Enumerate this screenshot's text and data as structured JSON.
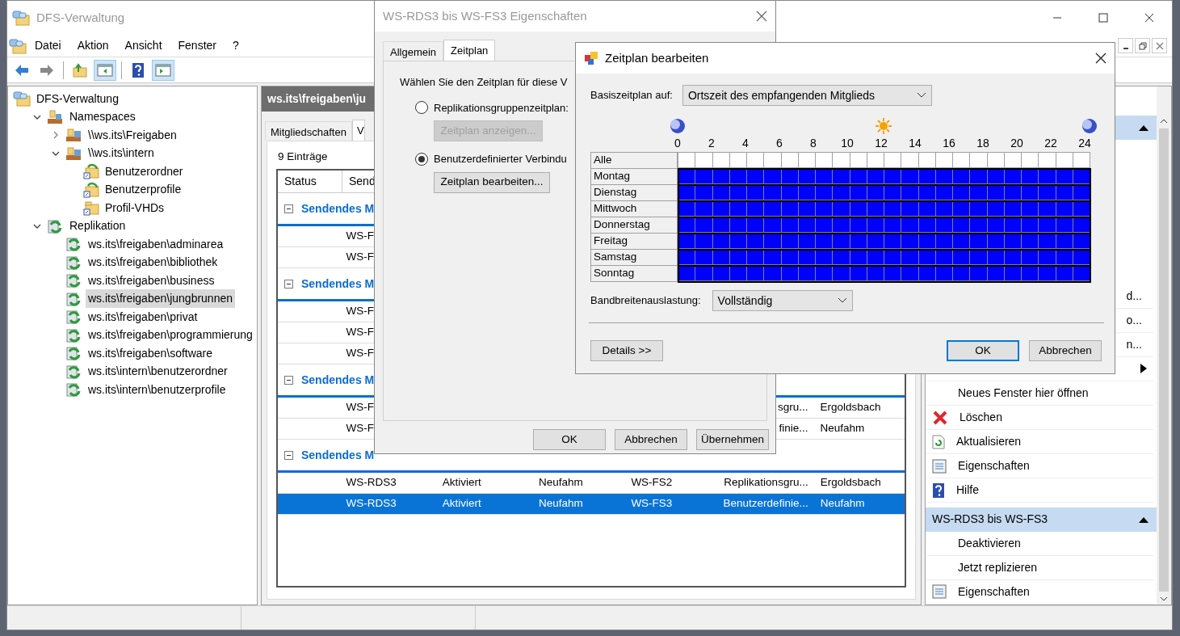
{
  "main_window": {
    "title": "DFS-Verwaltung",
    "menu": [
      "Datei",
      "Aktion",
      "Ansicht",
      "Fenster",
      "?"
    ],
    "toolbar": [
      {
        "kind": "back"
      },
      {
        "kind": "forward"
      },
      {
        "kind": "separator"
      },
      {
        "kind": "up",
        "pressed": false
      },
      {
        "kind": "tree",
        "pressed": true
      },
      {
        "kind": "separator"
      },
      {
        "kind": "help",
        "pressed": false
      },
      {
        "kind": "actions",
        "pressed": true
      }
    ]
  },
  "tree": [
    {
      "label": "DFS-Verwaltung",
      "kind": "root",
      "selected": false,
      "children": [
        {
          "label": "Namespaces",
          "kind": "namespaces",
          "selected": false,
          "expanded": true,
          "children": [
            {
              "label": "\\\\ws.its\\Freigaben",
              "kind": "namespace",
              "selected": false,
              "expanded": false
            },
            {
              "label": "\\\\ws.its\\intern",
              "kind": "namespace",
              "selected": false,
              "expanded": true,
              "children": [
                {
                  "label": "Benutzerordner",
                  "kind": "link",
                  "selected": false
                },
                {
                  "label": "Benutzerprofile",
                  "kind": "link",
                  "selected": false
                },
                {
                  "label": "Profil-VHDs",
                  "kind": "folder",
                  "selected": false
                }
              ]
            }
          ]
        },
        {
          "label": "Replikation",
          "kind": "replication",
          "selected": false,
          "expanded": true,
          "children": [
            {
              "label": "ws.its\\freigaben\\adminarea",
              "kind": "group",
              "selected": false
            },
            {
              "label": "ws.its\\freigaben\\bibliothek",
              "kind": "group",
              "selected": false
            },
            {
              "label": "ws.its\\freigaben\\business",
              "kind": "group",
              "selected": false
            },
            {
              "label": "ws.its\\freigaben\\jungbrunnen",
              "kind": "group",
              "selected": true
            },
            {
              "label": "ws.its\\freigaben\\privat",
              "kind": "group",
              "selected": false
            },
            {
              "label": "ws.its\\freigaben\\programmierung",
              "kind": "group",
              "selected": false
            },
            {
              "label": "ws.its\\freigaben\\software",
              "kind": "group",
              "selected": false
            },
            {
              "label": "ws.its\\intern\\benutzerordner",
              "kind": "group",
              "selected": false
            },
            {
              "label": "ws.its\\intern\\benutzerprofile",
              "kind": "group",
              "selected": false
            }
          ]
        }
      ]
    }
  ],
  "content": {
    "header": "ws.its\\freigaben\\ju",
    "tabs": [
      {
        "label": "Mitgliedschaften",
        "selected": false
      },
      {
        "label": "V",
        "selected": true
      }
    ],
    "count": "9 Einträge",
    "columns": [
      "Status",
      "Send"
    ],
    "groups": [
      {
        "title": "Sendendes M",
        "expanded": true,
        "rows": [
          {
            "selected": false,
            "column_2": "WS-F"
          },
          {
            "selected": false,
            "column_2": "WS-F"
          }
        ]
      },
      {
        "title": "Sendendes M",
        "expanded": true,
        "rows": [
          {
            "selected": false,
            "column_2": "WS-F"
          },
          {
            "selected": false,
            "column_2": "WS-F"
          },
          {
            "selected": false,
            "column_2": "WS-F"
          }
        ]
      },
      {
        "title": "Sendendes M",
        "expanded": true,
        "rows": [
          {
            "selected": false,
            "column_2": "WS-F",
            "column_6": "sgru...",
            "column_7": "Ergoldsbach"
          },
          {
            "selected": false,
            "column_2": "WS-F",
            "column_6": "finie...",
            "column_7": "Neufahm"
          }
        ]
      },
      {
        "title": "Sendendes M",
        "expanded": true,
        "rows": [
          {
            "selected": false,
            "column_2": "WS-RDS3",
            "column_3": "Aktiviert",
            "column_4": "Neufahm",
            "column_5": "WS-FS2",
            "column_6": "Replikationsgru...",
            "column_7": "Ergoldsbach"
          },
          {
            "selected": true,
            "column_2": "WS-RDS3",
            "column_3": "Aktiviert",
            "column_4": "Neufahm",
            "column_5": "WS-FS3",
            "column_6": "Benutzerdefinie...",
            "column_7": "Neufahm"
          }
        ]
      }
    ]
  },
  "actions": {
    "items": [
      {
        "kind": "partial",
        "label": "d..."
      },
      {
        "kind": "partial",
        "label": "o..."
      },
      {
        "kind": "partial",
        "label": "n..."
      },
      {
        "kind": "submenu"
      },
      {
        "kind": "plain",
        "label": "Neues Fenster hier öffnen"
      },
      {
        "kind": "delete",
        "label": "Löschen"
      },
      {
        "kind": "refresh",
        "label": "Aktualisieren"
      },
      {
        "kind": "properties",
        "label": "Eigenschaften"
      },
      {
        "kind": "help",
        "label": "Hilfe"
      }
    ],
    "section": "WS-RDS3 bis WS-FS3",
    "section_items": [
      {
        "kind": "plain",
        "label": "Deaktivieren"
      },
      {
        "kind": "plain",
        "label": "Jetzt replizieren"
      },
      {
        "kind": "properties",
        "label": "Eigenschaften"
      }
    ]
  },
  "properties_dialog": {
    "title": "WS-RDS3 bis WS-FS3 Eigenschaften",
    "tabs": [
      {
        "label": "Allgemein",
        "selected": false
      },
      {
        "label": "Zeitplan",
        "selected": true
      }
    ],
    "prompt": "Wählen Sie den Zeitplan für diese V",
    "options": [
      {
        "label": "Replikationsgruppenzeitplan:",
        "selected": false,
        "button": {
          "label": "Zeitplan anzeigen...",
          "disabled": true
        }
      },
      {
        "label": "Benutzerdefinierter Verbindu",
        "selected": true,
        "button": {
          "label": "Zeitplan bearbeiten...",
          "disabled": false
        }
      }
    ],
    "buttons": [
      "OK",
      "Abbrechen",
      "Übernehmen"
    ]
  },
  "schedule_dialog": {
    "title": "Zeitplan bearbeiten",
    "base_label": "Basiszeitplan auf:",
    "base_value": "Ortszeit des empfangenden Mitglieds",
    "hours": [
      "0",
      "2",
      "4",
      "6",
      "8",
      "10",
      "12",
      "14",
      "16",
      "18",
      "20",
      "22",
      "24"
    ],
    "all_label": "Alle",
    "days": [
      {
        "label": "Montag",
        "active": true
      },
      {
        "label": "Dienstag",
        "active": true
      },
      {
        "label": "Mittwoch",
        "active": true
      },
      {
        "label": "Donnerstag",
        "active": true
      },
      {
        "label": "Freitag",
        "active": true
      },
      {
        "label": "Samstag",
        "active": true
      },
      {
        "label": "Sonntag",
        "active": true
      }
    ],
    "bandwidth_label": "Bandbreitenauslastung:",
    "bandwidth_value": "Vollständig",
    "details_button": "Details >>",
    "buttons": [
      {
        "label": "OK",
        "focused": true
      },
      {
        "label": "Abbrechen",
        "focused": false
      }
    ]
  }
}
